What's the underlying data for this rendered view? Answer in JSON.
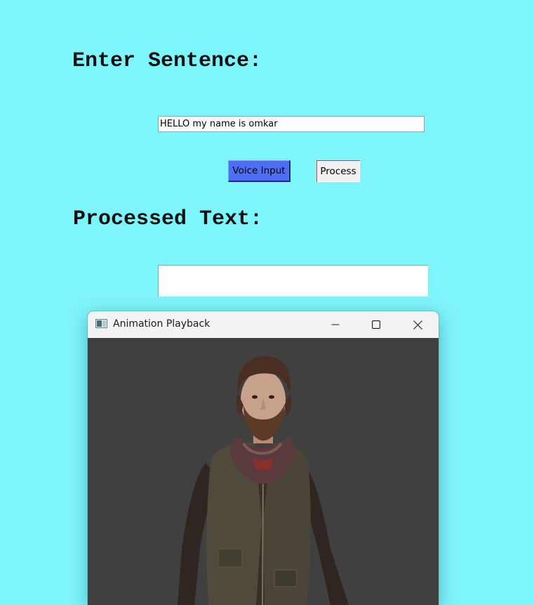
{
  "headings": {
    "enter_sentence": "Enter Sentence:",
    "processed_text": "Processed Text:"
  },
  "sentence_input": {
    "value": "HELLO my name is omkar"
  },
  "buttons": {
    "voice_input": "Voice Input",
    "process": "Process"
  },
  "processed_output": {
    "value": ""
  },
  "animation_window": {
    "title": "Animation Playback",
    "icon": "app-window-icon",
    "controls": [
      "minimize-icon",
      "maximize-icon",
      "close-icon"
    ],
    "content": "animated-person-figure"
  },
  "colors": {
    "background": "#7ef5fb",
    "voice_button": "#4e6ef6",
    "process_button": "#f0f0f0",
    "animation_background": "#404040"
  }
}
